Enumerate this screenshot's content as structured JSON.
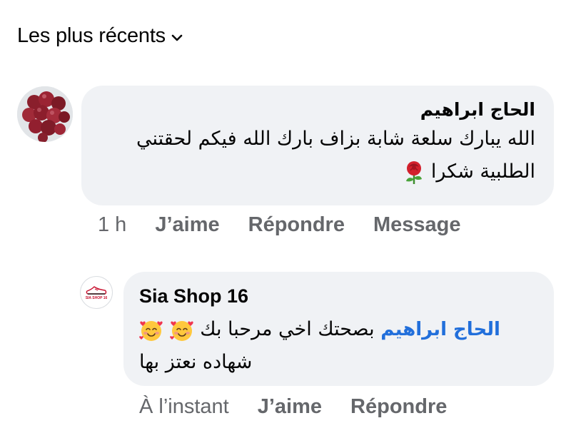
{
  "sort": {
    "label": "Les plus récents",
    "icon": "chevron-down-icon"
  },
  "comments": [
    {
      "author": "الحاج ابراهيم",
      "line1": "الله يبارك سلعة شابة بزاف بارك الله فيكم لحقتني",
      "line2": "الطلبية  شكرا",
      "emoji": "rose-icon",
      "time": "1 h",
      "actions": [
        "J’aime",
        "Répondre",
        "Message"
      ]
    }
  ],
  "reply": {
    "author": "Sia Shop 16",
    "logo_text": "SIA SHOP 16",
    "mention": "الحاج ابراهيم",
    "line1": "بصحتك اخي مرحبا بك",
    "line2": "شهاده نعتز بها",
    "emoji": "smiling-face-with-hearts-icon",
    "time": "À l’instant",
    "actions": [
      "J’aime",
      "Répondre"
    ]
  },
  "colors": {
    "bubble": "#f0f2f5",
    "mention": "#216fdb",
    "meta": "#65676b",
    "text": "#050505"
  }
}
